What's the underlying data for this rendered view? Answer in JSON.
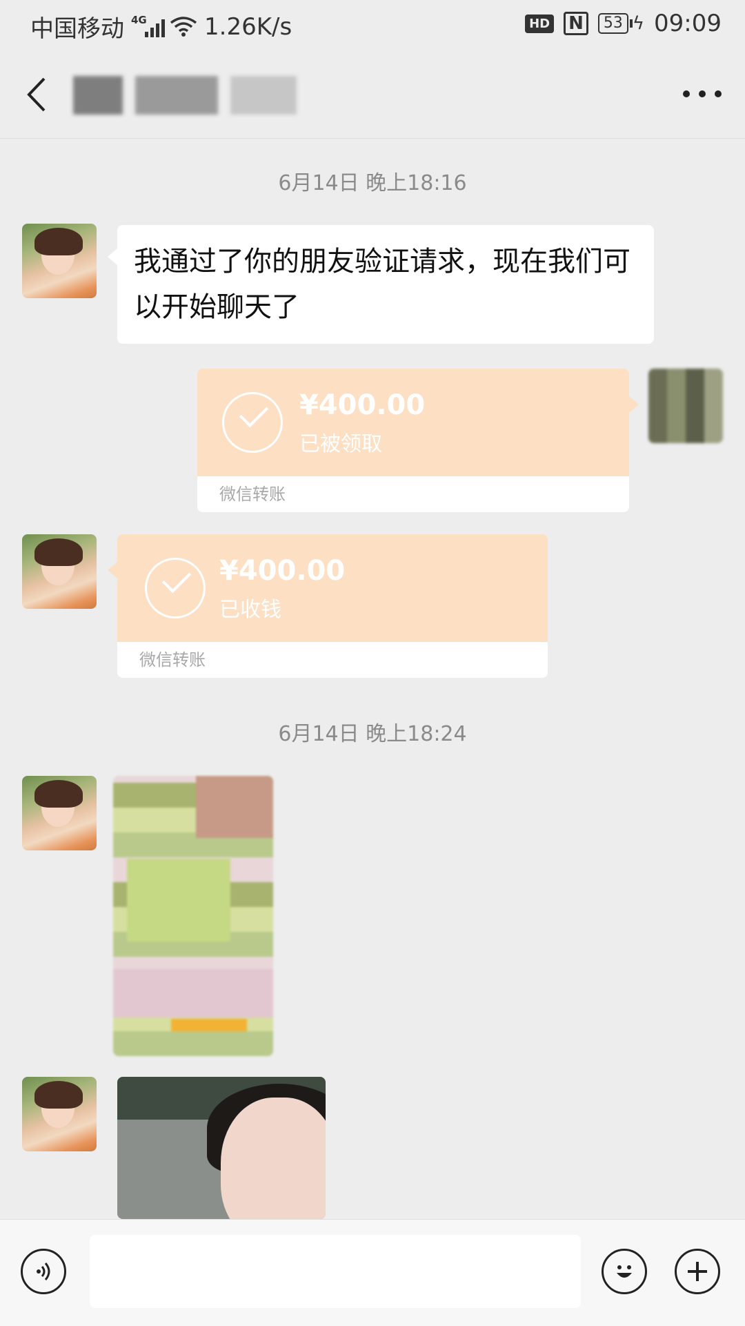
{
  "status_bar": {
    "carrier": "中国移动",
    "network": "4G",
    "speed": "1.26K/s",
    "hd": "HD",
    "nfc": "N",
    "battery": "53",
    "time": "09:09"
  },
  "header": {
    "icons": [
      "back-icon",
      "more-icon"
    ]
  },
  "chat": {
    "timestamp_1": "6月14日 晚上18:16",
    "msg_friend_text": "我通过了你的朋友验证请求，现在我们可以开始聊天了",
    "transfer_sent": {
      "amount": "¥400.00",
      "status": "已被领取",
      "footer": "微信转账"
    },
    "transfer_received": {
      "amount": "¥400.00",
      "status": "已收钱",
      "footer": "微信转账"
    },
    "timestamp_2": "6月14日 晚上18:24"
  },
  "input_bar": {
    "icons": [
      "voice-icon",
      "emoji-icon",
      "plus-icon"
    ]
  },
  "colors": {
    "background": "#ededed",
    "transfer": "#fde0c4",
    "bubble": "#ffffff"
  }
}
